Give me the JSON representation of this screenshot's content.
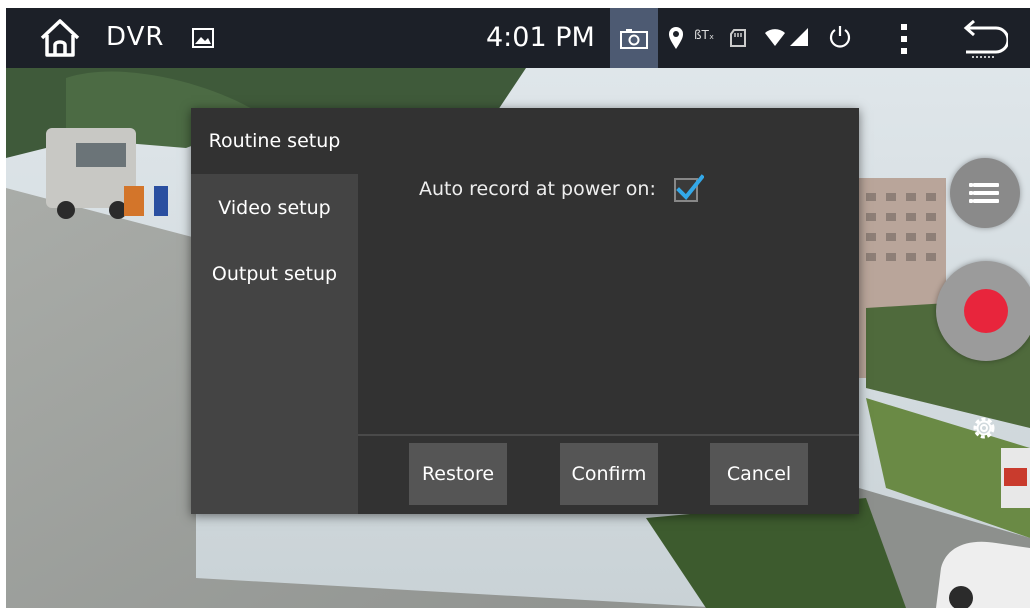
{
  "statusbar": {
    "app_title": "DVR",
    "time": "4:01 PM",
    "bt_text": "ßTₓ",
    "icons": [
      "home-icon",
      "gallery-icon",
      "camera-icon",
      "location-icon",
      "bluetooth-icon",
      "sd-card-icon",
      "wifi-icon",
      "signal-icon",
      "power-icon",
      "overflow-menu-icon",
      "back-icon"
    ]
  },
  "dialog": {
    "tabs": [
      {
        "label": "Routine setup",
        "active": true
      },
      {
        "label": "Video setup",
        "active": false
      },
      {
        "label": "Output setup",
        "active": false
      }
    ],
    "option": {
      "label": "Auto record at power on:",
      "checked": true
    },
    "buttons": {
      "restore": "Restore",
      "confirm": "Confirm",
      "cancel": "Cancel"
    }
  },
  "controls": {
    "icons": [
      "list-icon",
      "record-icon",
      "settings-gear-icon"
    ]
  },
  "colors": {
    "statusbar_bg": "#1c2028",
    "dialog_bg": "#323232",
    "sidebar_bg": "#444444",
    "button_bg": "#555555",
    "checkbox_tick": "#33a8e8",
    "record_red": "#e8253c"
  }
}
